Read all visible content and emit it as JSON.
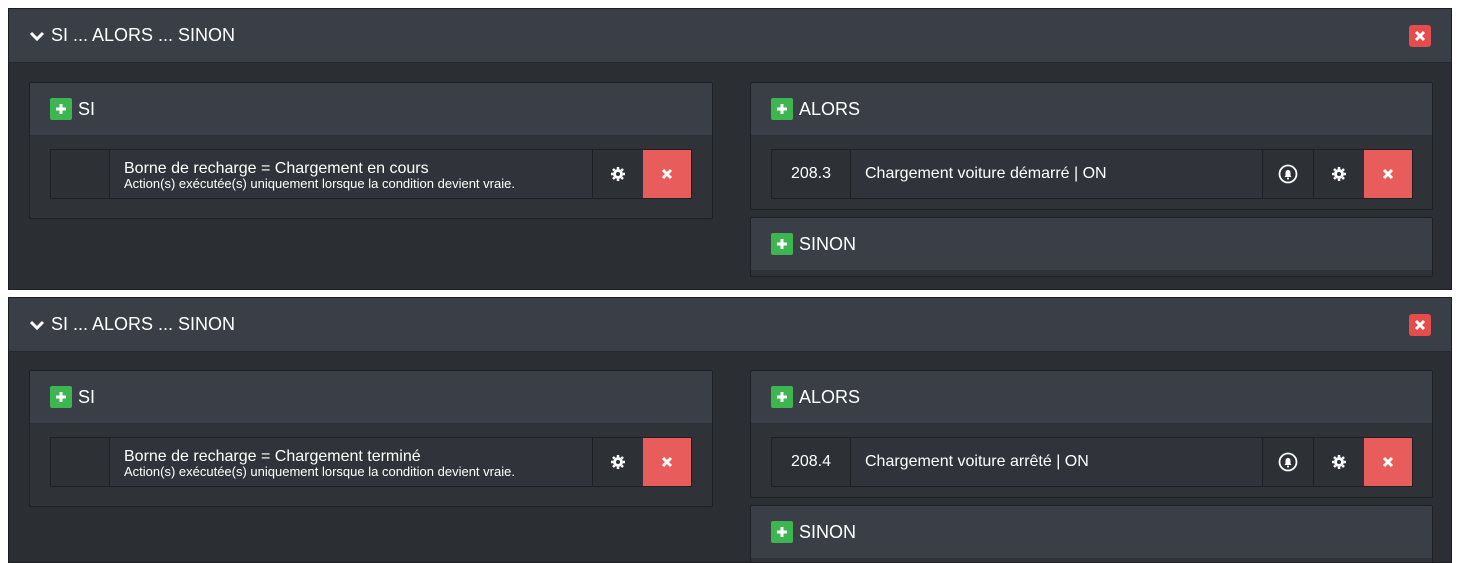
{
  "blocks": [
    {
      "title": "SI ... ALORS ... SINON",
      "si": {
        "label": "SI",
        "condition": "Borne de recharge = Chargement en cours",
        "note": "Action(s) exécutée(s) uniquement lorsque la condition devient vraie."
      },
      "alors": {
        "label": "ALORS",
        "id": "208.3",
        "action": "Chargement voiture démarré | ON"
      },
      "sinon": {
        "label": "SINON"
      }
    },
    {
      "title": "SI ... ALORS ... SINON",
      "si": {
        "label": "SI",
        "condition": "Borne de recharge = Chargement terminé",
        "note": "Action(s) exécutée(s) uniquement lorsque la condition devient vraie."
      },
      "alors": {
        "label": "ALORS",
        "id": "208.4",
        "action": "Chargement voiture arrêté | ON"
      },
      "sinon": {
        "label": "SINON"
      }
    }
  ],
  "icons": {
    "chevron": "chevron-down-icon",
    "close": "close-icon",
    "plus": "plus-icon",
    "gear": "gear-icon",
    "bell": "bell-icon"
  },
  "colors": {
    "danger": "#e85c5c",
    "success": "#3db550",
    "header": "#3a3f47",
    "body": "#2b2e33"
  }
}
